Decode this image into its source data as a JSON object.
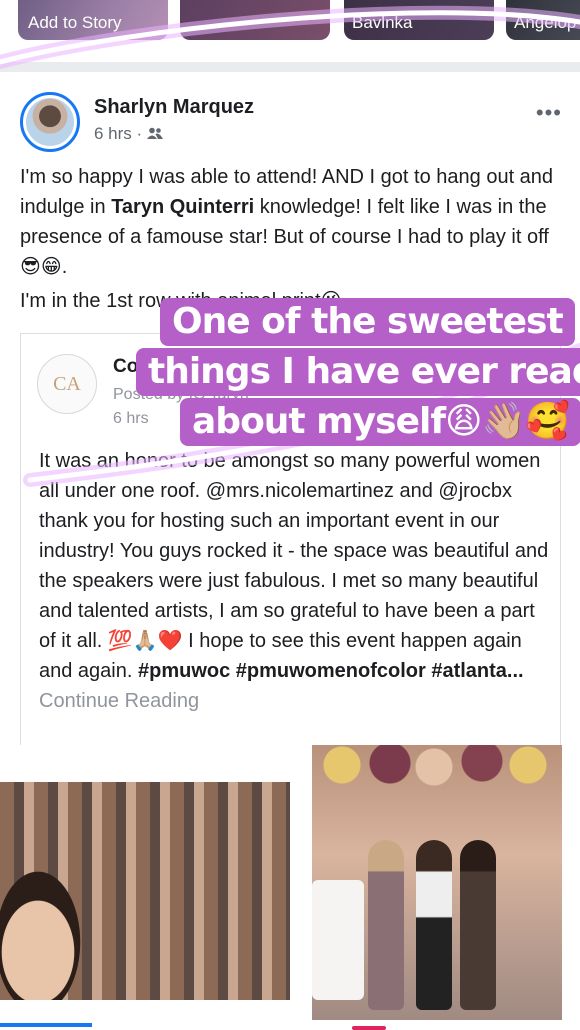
{
  "stories": [
    {
      "label": "Add to Story"
    },
    {
      "label": ""
    },
    {
      "label": "Bavlnka"
    },
    {
      "label": "Angelop"
    }
  ],
  "post": {
    "author": "Sharlyn Marquez",
    "time": "6 hrs",
    "audience_icon": "friends-icon",
    "more": "•••",
    "text_line1_a": "I'm so happy I was able to attend! AND I got to hang out and indulge in ",
    "text_line1_bold": "Taryn Quinterri",
    "text_line1_b": " knowledge! I felt like I was in the presence of a famouse star! But of course I had to play it off😎😁.",
    "text_line2": "I'm in the 1st row with animal print😘."
  },
  "shared": {
    "logo_text": "CA",
    "name": "Cosmetics",
    "posted_by": "Posted by IG Taryn",
    "time": "6 hrs",
    "text_1": "It was an honor to be amongst so many powerful women all under one roof. @mrs.nicolemartinez and @jrocbx thank you for hosting such an important event in our industry! You guys rocked it - the space was beautiful and the speakers were just fabulous. I met so many beautiful and talented artists, I am so grateful to have been a part of it all. 💯🙏🏼❤️ I hope to see this event happen again and again. ",
    "hashtags": "#pmuwoc #pmuwomenofcolor #atlanta...",
    "continue": "Continue Reading"
  },
  "overlay": {
    "line1": "One of the sweetest",
    "line2": "things I have ever read",
    "line3": "about myself😩👋🏼🥰",
    "highlight_color": "#b560c9",
    "neon_color": "#e9b3ff"
  }
}
